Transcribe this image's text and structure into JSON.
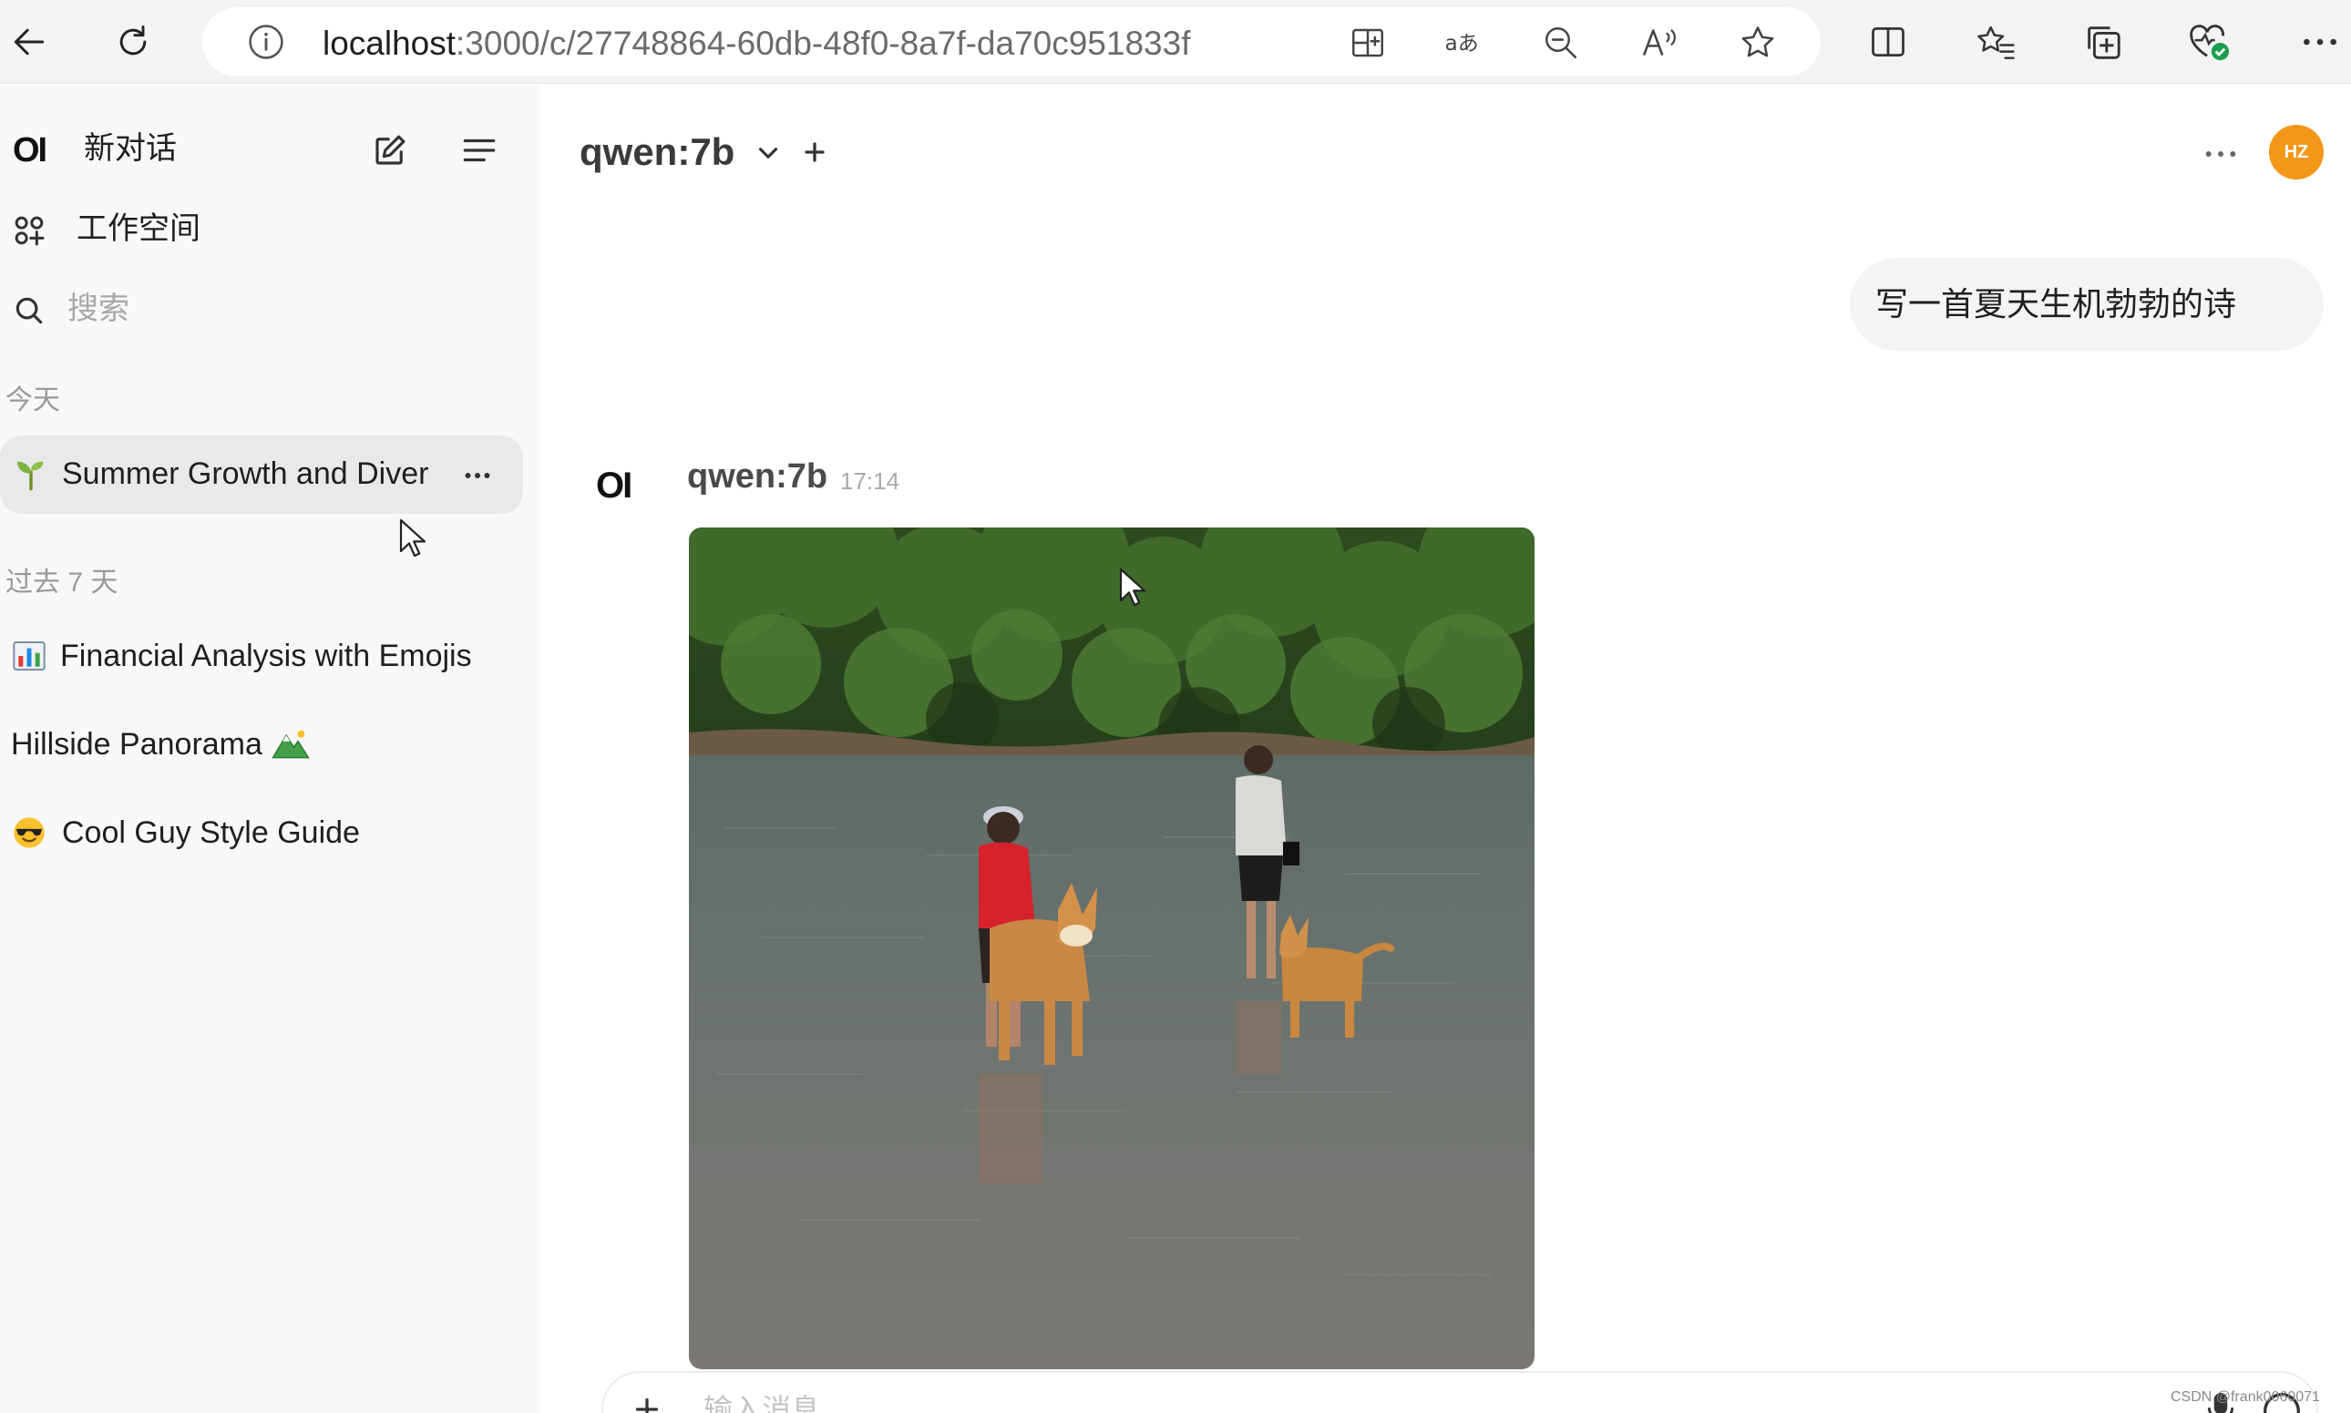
{
  "browser": {
    "url_host": "localhost",
    "url_path": ":3000/c/27748864-60db-48f0-8a7f-da70c951833f",
    "icons": [
      "back-arrow-icon",
      "refresh-icon",
      "info-icon",
      "app-available-icon",
      "read-aloud-translate-icon",
      "zoom-out-icon",
      "read-aloud-icon",
      "favorite-star-icon",
      "split-screen-icon",
      "favorites-icon",
      "collections-icon",
      "browser-essentials-icon",
      "more-icon"
    ]
  },
  "sidebar": {
    "brand": "OI",
    "new_chat_label": "新对话",
    "workspace_label": "工作空间",
    "search_placeholder": "搜索",
    "sections": [
      {
        "label": "今天",
        "chats": [
          {
            "title": "Summer Growth and Diver",
            "emoji": "seedling"
          }
        ]
      },
      {
        "label": "过去 7 天",
        "chats": [
          {
            "title": "Financial Analysis with Emojis",
            "emoji": "bar-chart"
          },
          {
            "title": "Hillside Panorama",
            "emoji": "mountain"
          },
          {
            "title": "Cool Guy Style Guide",
            "emoji": "sunglasses-face"
          }
        ]
      }
    ]
  },
  "main": {
    "model": "qwen:7b",
    "avatar_initials": "HZ",
    "user_message": "写一首夏天生机勃勃的诗",
    "assistant": {
      "logo": "OI",
      "name": "qwen:7b",
      "time": "17:14",
      "image_subject": "photo"
    },
    "input_placeholder": "输入消息"
  },
  "watermark": "CSDN @frank0060071",
  "colors": {
    "avatar": "#f29718",
    "sidebar_bg": "#f8f8f8",
    "active_chat_bg": "#e9e9e9",
    "user_bubble_bg": "#f4f4f4"
  }
}
